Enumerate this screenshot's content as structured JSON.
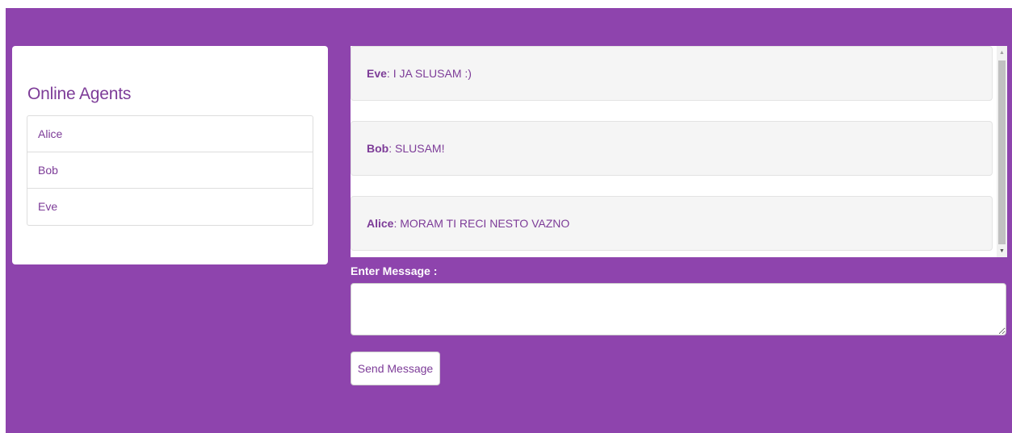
{
  "agents": {
    "title": "Online Agents",
    "items": [
      "Alice",
      "Bob",
      "Eve"
    ]
  },
  "messages": [
    {
      "sender": "Eve",
      "text": ": I JA SLUSAM :)"
    },
    {
      "sender": "Bob",
      "text": ": SLUSAM!"
    },
    {
      "sender": "Alice",
      "text": ": MORAM TI RECI NESTO VAZNO"
    }
  ],
  "composer": {
    "label": "Enter Message :",
    "input_value": "",
    "send_label": "Send Message"
  },
  "scrollbar": {
    "up_icon": "▲",
    "down_icon": "▼"
  },
  "colors": {
    "background": "#8e44ad",
    "text_accent": "#7d3c98",
    "message_bg": "#f5f5f5"
  }
}
